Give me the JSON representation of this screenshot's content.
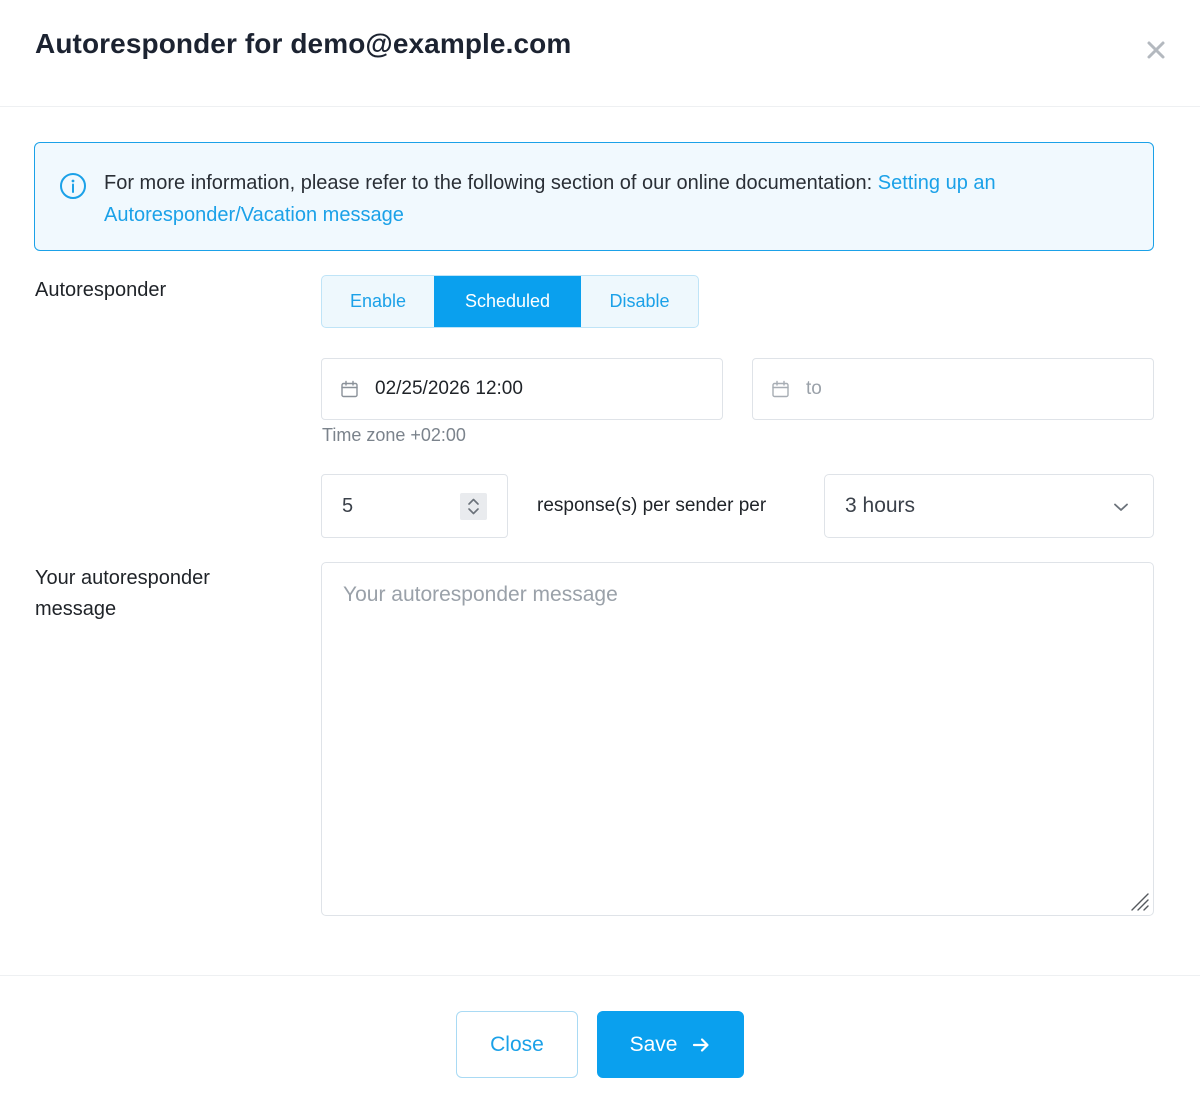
{
  "dialog": {
    "title": "Autoresponder for demo@example.com"
  },
  "info": {
    "text": "For more information, please refer to the following section of our online documentation: ",
    "link_text": "Setting up an Autoresponder/Vacation message"
  },
  "autoresponder": {
    "label": "Autoresponder",
    "modes": [
      "Enable",
      "Scheduled",
      "Disable"
    ],
    "selected_mode": "Scheduled"
  },
  "schedule": {
    "from_value": "02/25/2026 12:00",
    "to_placeholder": "to",
    "timezone_text": "Time zone +02:00"
  },
  "rate": {
    "count": "5",
    "text": "response(s) per sender per",
    "period": "3 hours"
  },
  "message": {
    "label": "Your autoresponder message",
    "placeholder": "Your autoresponder message"
  },
  "footer": {
    "close_label": "Close",
    "save_label": "Save"
  },
  "colors": {
    "accent": "#0aa0ee",
    "link": "#1ba1e8",
    "alert_bg": "#f1f9fe"
  }
}
